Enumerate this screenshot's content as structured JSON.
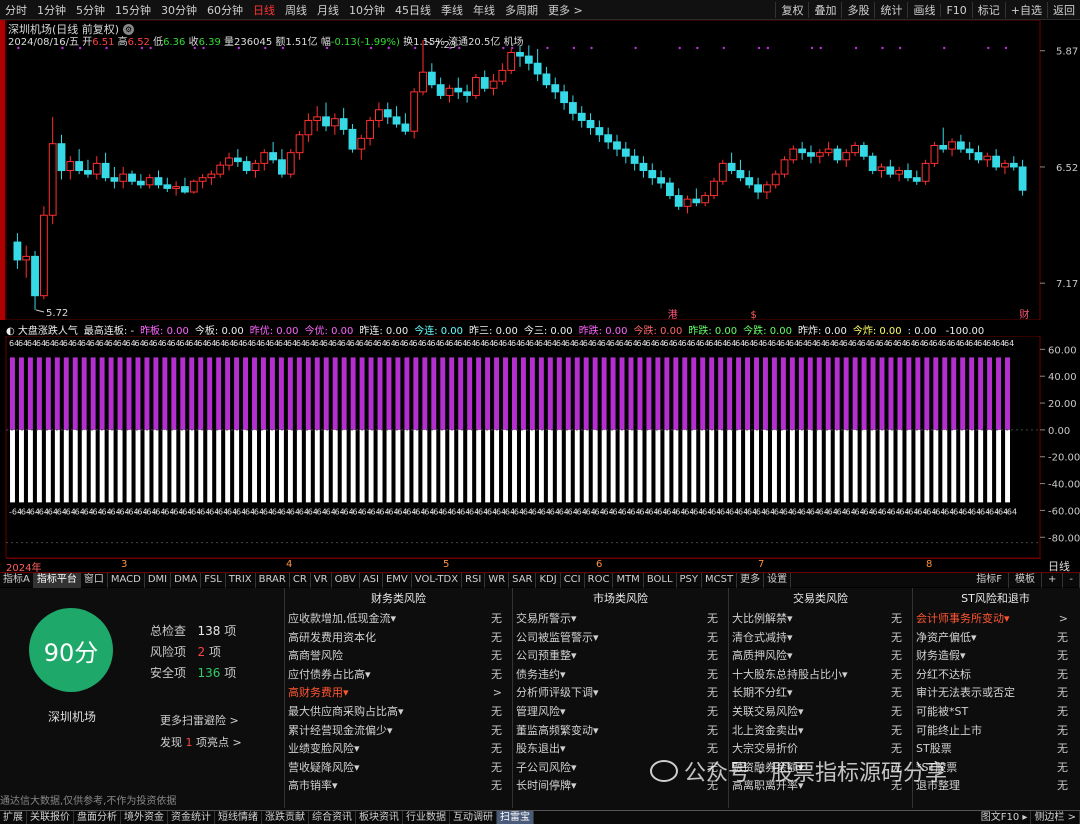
{
  "timeframes": [
    "分时",
    "1分钟",
    "5分钟",
    "15分钟",
    "30分钟",
    "60分钟",
    "日线",
    "周线",
    "月线",
    "10分钟",
    "45日线",
    "季线",
    "年线",
    "多周期",
    "更多 >"
  ],
  "active_timeframe": "日线",
  "tools": [
    "复权",
    "叠加",
    "多股",
    "统计",
    "画线",
    "F10",
    "标记",
    "+自选",
    "返回"
  ],
  "stock": {
    "title": "深圳机场(日线 前复权)",
    "date": "2024/08/16/五",
    "open_label": "开",
    "open": "6.51",
    "high_label": "高",
    "high": "6.52",
    "low_label": "低",
    "low": "6.36",
    "close_label": "收",
    "close": "6.39",
    "vol_label": "量",
    "vol": "236045",
    "amount_label": "额",
    "amount": "1.51亿",
    "chg_label": "幅",
    "chg": "-0.13(-1.99%)",
    "turn_label": "换",
    "turn": "1.15%",
    "float_label": "流通",
    "float": "20.5亿",
    "industry": "机场"
  },
  "price_axis": [
    "7.17",
    "6.52",
    "5.87"
  ],
  "chart_marks": {
    "high": "7.23",
    "low": "5.72",
    "markers": [
      "港",
      "$",
      "财"
    ]
  },
  "indicator": {
    "name": "大盘涨跌人气",
    "fields": [
      {
        "k": "最高连板:",
        "v": "-"
      },
      {
        "k": "昨板:",
        "v": "0.00"
      },
      {
        "k": "今板:",
        "v": "0.00"
      },
      {
        "k": "昨优:",
        "v": "0.00"
      },
      {
        "k": "今优:",
        "v": "0.00"
      },
      {
        "k": "昨连:",
        "v": "0.00"
      },
      {
        "k": "今连:",
        "v": "0.00"
      },
      {
        "k": "昨三:",
        "v": "0.00"
      },
      {
        "k": "今三:",
        "v": "0.00"
      },
      {
        "k": "昨跌:",
        "v": "0.00"
      },
      {
        "k": "今跌:",
        "v": "0.00"
      },
      {
        "k": "昨跌:",
        "v": "0.00"
      },
      {
        "k": "今跌:",
        "v": "0.00"
      },
      {
        "k": "昨炸:",
        "v": "0.00"
      },
      {
        "k": "今炸:",
        "v": "0.00"
      },
      {
        "k": ":",
        "v": "0.00"
      },
      {
        "k": "",
        "v": "-100.00"
      }
    ],
    "axis": [
      "60.00",
      "40.00",
      "20.00",
      "0.00",
      "-20.00",
      "-40.00",
      "-60.00",
      "-80.00"
    ],
    "top_label": "64",
    "bottom_label": "-64"
  },
  "time_axis": [
    "2024年",
    "3",
    "4",
    "5",
    "6",
    "7",
    "8"
  ],
  "period_label": "日线",
  "indicator_tabs": [
    "指标A",
    "指标平台",
    "窗口",
    "MACD",
    "DMI",
    "DMA",
    "FSL",
    "TRIX",
    "BRAR",
    "CR",
    "VR",
    "OBV",
    "ASI",
    "EMV",
    "VOL-TDX",
    "RSI",
    "WR",
    "SAR",
    "KDJ",
    "CCI",
    "ROC",
    "MTM",
    "BOLL",
    "PSY",
    "MCST",
    "更多",
    "设置"
  ],
  "right_tabs": [
    "指标F",
    "模板",
    "+",
    "-"
  ],
  "risk": {
    "score": "90分",
    "name": "深圳机场",
    "checked_label": "总检查",
    "checked": "138",
    "risk_label": "风险项",
    "risk_count": "2",
    "safe_label": "安全项",
    "safe": "136",
    "unit": "项",
    "more": "更多扫雷避险 >",
    "found_prefix": "发现",
    "found": "1",
    "found_suffix": "项亮点 >",
    "disclaimer": "通达信大数据,仅供参考,不作为投资依据",
    "columns": [
      {
        "title": "财务类风险",
        "items": [
          [
            "应收款增加,低现金流▾",
            "无"
          ],
          [
            "高研发费用资本化",
            "无"
          ],
          [
            "高商誉风险",
            "无"
          ],
          [
            "应付债券占比高▾",
            "无"
          ],
          [
            "高财务费用▾",
            ">"
          ],
          [
            "最大供应商采购占比高▾",
            "无"
          ],
          [
            "累计经营现金流偏少▾",
            "无"
          ],
          [
            "业绩变脸风险▾",
            "无"
          ],
          [
            "营收疑降风险▾",
            "无"
          ],
          [
            "高市销率▾",
            "无"
          ]
        ],
        "hl": 4
      },
      {
        "title": "市场类风险",
        "items": [
          [
            "交易所警示▾",
            "无"
          ],
          [
            "公司被监管警示▾",
            "无"
          ],
          [
            "公司预重整▾",
            "无"
          ],
          [
            "债务违约▾",
            "无"
          ],
          [
            "分析师评级下调▾",
            "无"
          ],
          [
            "管理风险▾",
            "无"
          ],
          [
            "董监高频繁变动▾",
            "无"
          ],
          [
            "股东退出▾",
            "无"
          ],
          [
            "子公司风险▾",
            "无"
          ],
          [
            "长时间停牌▾",
            "无"
          ]
        ],
        "hl": -1
      },
      {
        "title": "交易类风险",
        "items": [
          [
            "大比例解禁▾",
            "无"
          ],
          [
            "清仓式减持▾",
            "无"
          ],
          [
            "高质押风险▾",
            "无"
          ],
          [
            "十大股东总持股占比小▾",
            "无"
          ],
          [
            "长期不分红▾",
            "无"
          ],
          [
            "关联交易风险▾",
            "无"
          ],
          [
            "北上资金卖出▾",
            "无"
          ],
          [
            "大宗交易折价",
            "无"
          ],
          [
            "融资融券余额▾",
            "无"
          ],
          [
            "高离职离开率▾",
            "无"
          ]
        ],
        "hl": -1
      },
      {
        "title": "ST风险和退市",
        "items": [
          [
            "会计师事务所变动▾",
            ">"
          ],
          [
            "净资产偏低▾",
            "无"
          ],
          [
            "财务造假▾",
            "无"
          ],
          [
            "分红不达标",
            "无"
          ],
          [
            "审计无法表示或否定",
            "无"
          ],
          [
            "可能被*ST",
            "无"
          ],
          [
            "可能终止上市",
            "无"
          ],
          [
            "ST股票",
            "无"
          ],
          [
            "*ST股票",
            "无"
          ],
          [
            "退市整理",
            "无"
          ]
        ],
        "hl": 0
      }
    ]
  },
  "bottom_tabs": [
    "扩展",
    "关联报价",
    "盘面分析",
    "境外资金",
    "资金统计",
    "短线情绪",
    "涨跌贡献",
    "综合资讯",
    "板块资讯",
    "行业数据",
    "互动调研",
    "扫雷宝"
  ],
  "active_bottom": "扫雷宝",
  "bottom_right": "图文F10 ▸",
  "bottom_right2": "侧边栏 >",
  "watermark": "公众号 · 股票指标源码分享",
  "colors": {
    "up": "#ff3030",
    "down": "#36d9e6",
    "magenta": "#b52fd0",
    "white": "#ffffff",
    "accent": "#1ea86a",
    "border": "#6a0000"
  },
  "chart_data": {
    "type": "candlestick",
    "ylim": [
      5.72,
      7.23
    ],
    "y_ticks": [
      5.87,
      6.52,
      7.17
    ],
    "series": [
      {
        "name": "ohlc",
        "values": [
          [
            6.1,
            6.15,
            5.95,
            6.0
          ],
          [
            6.0,
            6.08,
            5.9,
            6.02
          ],
          [
            6.02,
            6.05,
            5.72,
            5.8
          ],
          [
            5.8,
            6.3,
            5.78,
            6.25
          ],
          [
            6.25,
            6.8,
            6.2,
            6.65
          ],
          [
            6.65,
            6.7,
            6.45,
            6.5
          ],
          [
            6.5,
            6.58,
            6.45,
            6.55
          ],
          [
            6.55,
            6.62,
            6.48,
            6.5
          ],
          [
            6.5,
            6.56,
            6.46,
            6.48
          ],
          [
            6.48,
            6.58,
            6.45,
            6.54
          ],
          [
            6.54,
            6.6,
            6.44,
            6.46
          ],
          [
            6.46,
            6.52,
            6.4,
            6.44
          ],
          [
            6.44,
            6.52,
            6.4,
            6.48
          ],
          [
            6.48,
            6.5,
            6.42,
            6.44
          ],
          [
            6.44,
            6.48,
            6.4,
            6.42
          ],
          [
            6.42,
            6.48,
            6.4,
            6.46
          ],
          [
            6.46,
            6.5,
            6.4,
            6.42
          ],
          [
            6.42,
            6.46,
            6.38,
            6.4
          ],
          [
            6.4,
            6.44,
            6.36,
            6.41
          ],
          [
            6.41,
            6.46,
            6.37,
            6.38
          ],
          [
            6.38,
            6.45,
            6.37,
            6.44
          ],
          [
            6.44,
            6.48,
            6.4,
            6.46
          ],
          [
            6.46,
            6.5,
            6.42,
            6.48
          ],
          [
            6.48,
            6.55,
            6.46,
            6.53
          ],
          [
            6.53,
            6.6,
            6.5,
            6.57
          ],
          [
            6.57,
            6.62,
            6.52,
            6.55
          ],
          [
            6.55,
            6.58,
            6.48,
            6.5
          ],
          [
            6.5,
            6.56,
            6.46,
            6.54
          ],
          [
            6.54,
            6.62,
            6.5,
            6.6
          ],
          [
            6.6,
            6.66,
            6.54,
            6.56
          ],
          [
            6.56,
            6.62,
            6.46,
            6.48
          ],
          [
            6.48,
            6.62,
            6.46,
            6.6
          ],
          [
            6.6,
            6.72,
            6.56,
            6.7
          ],
          [
            6.7,
            6.82,
            6.66,
            6.78
          ],
          [
            6.78,
            6.86,
            6.72,
            6.8
          ],
          [
            6.8,
            6.88,
            6.72,
            6.75
          ],
          [
            6.75,
            6.82,
            6.7,
            6.79
          ],
          [
            6.79,
            6.85,
            6.7,
            6.73
          ],
          [
            6.73,
            6.76,
            6.6,
            6.62
          ],
          [
            6.62,
            6.7,
            6.56,
            6.68
          ],
          [
            6.68,
            6.8,
            6.64,
            6.78
          ],
          [
            6.78,
            6.88,
            6.74,
            6.84
          ],
          [
            6.84,
            6.88,
            6.76,
            6.8
          ],
          [
            6.8,
            6.86,
            6.74,
            6.76
          ],
          [
            6.76,
            6.82,
            6.7,
            6.72
          ],
          [
            6.72,
            6.96,
            6.68,
            6.94
          ],
          [
            6.94,
            7.23,
            6.92,
            7.05
          ],
          [
            7.05,
            7.1,
            6.96,
            6.98
          ],
          [
            6.98,
            7.02,
            6.9,
            6.92
          ],
          [
            6.92,
            6.98,
            6.88,
            6.96
          ],
          [
            6.96,
            7.02,
            6.9,
            6.94
          ],
          [
            6.94,
            6.98,
            6.88,
            6.92
          ],
          [
            6.92,
            7.04,
            6.9,
            7.02
          ],
          [
            7.02,
            7.06,
            6.94,
            6.96
          ],
          [
            6.96,
            7.04,
            6.92,
            7.0
          ],
          [
            7.0,
            7.1,
            6.98,
            7.06
          ],
          [
            7.06,
            7.18,
            7.04,
            7.16
          ],
          [
            7.16,
            7.2,
            7.08,
            7.14
          ],
          [
            7.14,
            7.2,
            7.06,
            7.1
          ],
          [
            7.1,
            7.18,
            7.0,
            7.04
          ],
          [
            7.04,
            7.08,
            6.96,
            6.98
          ],
          [
            6.98,
            7.02,
            6.9,
            6.94
          ],
          [
            6.94,
            6.98,
            6.84,
            6.88
          ],
          [
            6.88,
            6.92,
            6.78,
            6.82
          ],
          [
            6.82,
            6.86,
            6.74,
            6.78
          ],
          [
            6.78,
            6.82,
            6.7,
            6.74
          ],
          [
            6.74,
            6.78,
            6.66,
            6.7
          ],
          [
            6.7,
            6.74,
            6.62,
            6.66
          ],
          [
            6.66,
            6.7,
            6.58,
            6.62
          ],
          [
            6.62,
            6.66,
            6.54,
            6.58
          ],
          [
            6.58,
            6.62,
            6.5,
            6.54
          ],
          [
            6.54,
            6.58,
            6.46,
            6.5
          ],
          [
            6.5,
            6.54,
            6.42,
            6.46
          ],
          [
            6.46,
            6.5,
            6.4,
            6.43
          ],
          [
            6.43,
            6.46,
            6.34,
            6.36
          ],
          [
            6.36,
            6.4,
            6.28,
            6.3
          ],
          [
            6.3,
            6.36,
            6.26,
            6.34
          ],
          [
            6.34,
            6.4,
            6.3,
            6.32
          ],
          [
            6.32,
            6.38,
            6.3,
            6.36
          ],
          [
            6.36,
            6.46,
            6.34,
            6.44
          ],
          [
            6.44,
            6.56,
            6.42,
            6.54
          ],
          [
            6.54,
            6.6,
            6.48,
            6.5
          ],
          [
            6.5,
            6.56,
            6.44,
            6.46
          ],
          [
            6.46,
            6.5,
            6.4,
            6.42
          ],
          [
            6.42,
            6.46,
            6.34,
            6.38
          ],
          [
            6.38,
            6.44,
            6.34,
            6.42
          ],
          [
            6.42,
            6.5,
            6.4,
            6.48
          ],
          [
            6.48,
            6.58,
            6.46,
            6.56
          ],
          [
            6.56,
            6.64,
            6.54,
            6.62
          ],
          [
            6.62,
            6.66,
            6.56,
            6.6
          ],
          [
            6.6,
            6.64,
            6.54,
            6.58
          ],
          [
            6.58,
            6.62,
            6.54,
            6.6
          ],
          [
            6.6,
            6.66,
            6.58,
            6.62
          ],
          [
            6.62,
            6.64,
            6.54,
            6.56
          ],
          [
            6.56,
            6.62,
            6.52,
            6.6
          ],
          [
            6.6,
            6.66,
            6.58,
            6.64
          ],
          [
            6.64,
            6.66,
            6.56,
            6.58
          ],
          [
            6.58,
            6.6,
            6.48,
            6.5
          ],
          [
            6.5,
            6.54,
            6.46,
            6.52
          ],
          [
            6.52,
            6.56,
            6.46,
            6.48
          ],
          [
            6.48,
            6.52,
            6.44,
            6.5
          ],
          [
            6.5,
            6.54,
            6.44,
            6.46
          ],
          [
            6.46,
            6.5,
            6.42,
            6.44
          ],
          [
            6.44,
            6.56,
            6.42,
            6.54
          ],
          [
            6.54,
            6.66,
            6.52,
            6.64
          ],
          [
            6.64,
            6.74,
            6.6,
            6.62
          ],
          [
            6.62,
            6.68,
            6.58,
            6.66
          ],
          [
            6.66,
            6.7,
            6.6,
            6.62
          ],
          [
            6.62,
            6.66,
            6.56,
            6.6
          ],
          [
            6.6,
            6.64,
            6.54,
            6.56
          ],
          [
            6.56,
            6.6,
            6.52,
            6.58
          ],
          [
            6.58,
            6.62,
            6.5,
            6.52
          ],
          [
            6.52,
            6.56,
            6.48,
            6.54
          ],
          [
            6.54,
            6.58,
            6.5,
            6.52
          ],
          [
            6.52,
            6.56,
            6.36,
            6.39
          ]
        ]
      }
    ]
  }
}
